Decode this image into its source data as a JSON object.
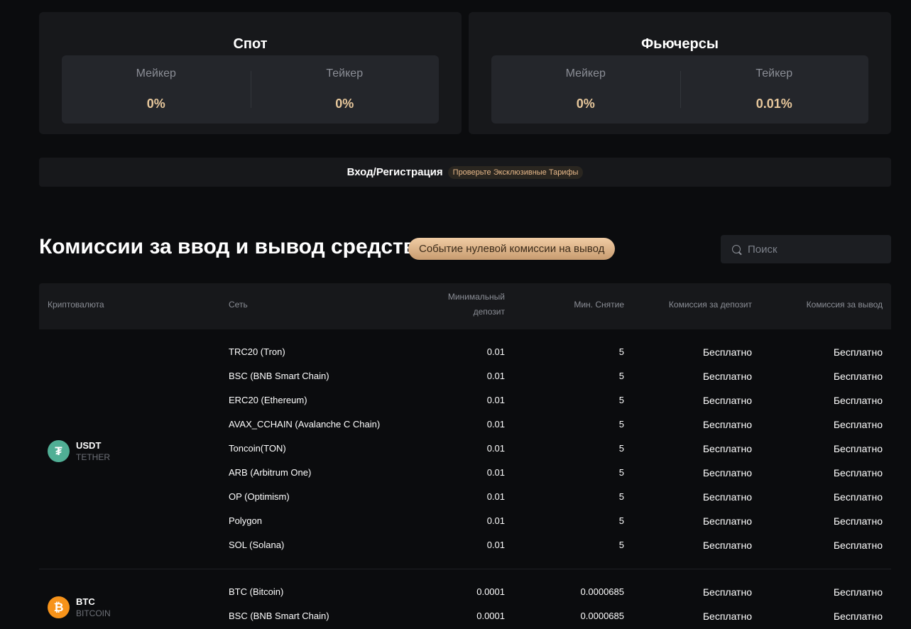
{
  "spot": {
    "title": "Спот",
    "maker_label": "Мейкер",
    "maker_value": "0%",
    "taker_label": "Тейкер",
    "taker_value": "0%"
  },
  "futures": {
    "title": "Фьючерсы",
    "maker_label": "Мейкер",
    "maker_value": "0%",
    "taker_label": "Тейкер",
    "taker_value": "0.01%"
  },
  "login_bar": {
    "login_text": "Вход/Регистрация",
    "promo_text": "Проверьте Эксклюзивные Тарифы"
  },
  "section": {
    "title": "Комиссии за ввод и вывод средств",
    "badge": "Событие нулевой комиссии на вывод"
  },
  "search": {
    "placeholder": "Поиск",
    "value": ""
  },
  "table": {
    "headers": {
      "crypto": "Криптовалюта",
      "network": "Сеть",
      "min_deposit_line1": "Минимальный",
      "min_deposit_line2": "депозит",
      "min_withdraw": "Мин. Снятие",
      "deposit_fee": "Комиссия за депозит",
      "withdraw_fee": "Комиссия за вывод"
    },
    "groups": [
      {
        "symbol": "USDT",
        "name": "TETHER",
        "icon": "tether-icon",
        "icon_color": "#50af95",
        "rows": [
          {
            "network": "TRC20 (Tron)",
            "min_deposit": "0.01",
            "min_withdraw": "5",
            "deposit_fee": "Бесплатно",
            "withdraw_fee": "Бесплатно"
          },
          {
            "network": "BSC (BNB Smart Chain)",
            "min_deposit": "0.01",
            "min_withdraw": "5",
            "deposit_fee": "Бесплатно",
            "withdraw_fee": "Бесплатно"
          },
          {
            "network": "ERC20 (Ethereum)",
            "min_deposit": "0.01",
            "min_withdraw": "5",
            "deposit_fee": "Бесплатно",
            "withdraw_fee": "Бесплатно"
          },
          {
            "network": "AVAX_CCHAIN (Avalanche C Chain)",
            "min_deposit": "0.01",
            "min_withdraw": "5",
            "deposit_fee": "Бесплатно",
            "withdraw_fee": "Бесплатно"
          },
          {
            "network": "Toncoin(TON)",
            "min_deposit": "0.01",
            "min_withdraw": "5",
            "deposit_fee": "Бесплатно",
            "withdraw_fee": "Бесплатно"
          },
          {
            "network": "ARB (Arbitrum One)",
            "min_deposit": "0.01",
            "min_withdraw": "5",
            "deposit_fee": "Бесплатно",
            "withdraw_fee": "Бесплатно"
          },
          {
            "network": "OP (Optimism)",
            "min_deposit": "0.01",
            "min_withdraw": "5",
            "deposit_fee": "Бесплатно",
            "withdraw_fee": "Бесплатно"
          },
          {
            "network": "Polygon",
            "min_deposit": "0.01",
            "min_withdraw": "5",
            "deposit_fee": "Бесплатно",
            "withdraw_fee": "Бесплатно"
          },
          {
            "network": "SOL (Solana)",
            "min_deposit": "0.01",
            "min_withdraw": "5",
            "deposit_fee": "Бесплатно",
            "withdraw_fee": "Бесплатно"
          }
        ]
      },
      {
        "symbol": "BTC",
        "name": "BITCOIN",
        "icon": "bitcoin-icon",
        "icon_color": "#f7931a",
        "rows": [
          {
            "network": "BTC (Bitcoin)",
            "min_deposit": "0.0001",
            "min_withdraw": "0.0000685",
            "deposit_fee": "Бесплатно",
            "withdraw_fee": "Бесплатно"
          },
          {
            "network": "BSC (BNB Smart Chain)",
            "min_deposit": "0.0001",
            "min_withdraw": "0.0000685",
            "deposit_fee": "Бесплатно",
            "withdraw_fee": "Бесплатно"
          }
        ]
      }
    ]
  }
}
